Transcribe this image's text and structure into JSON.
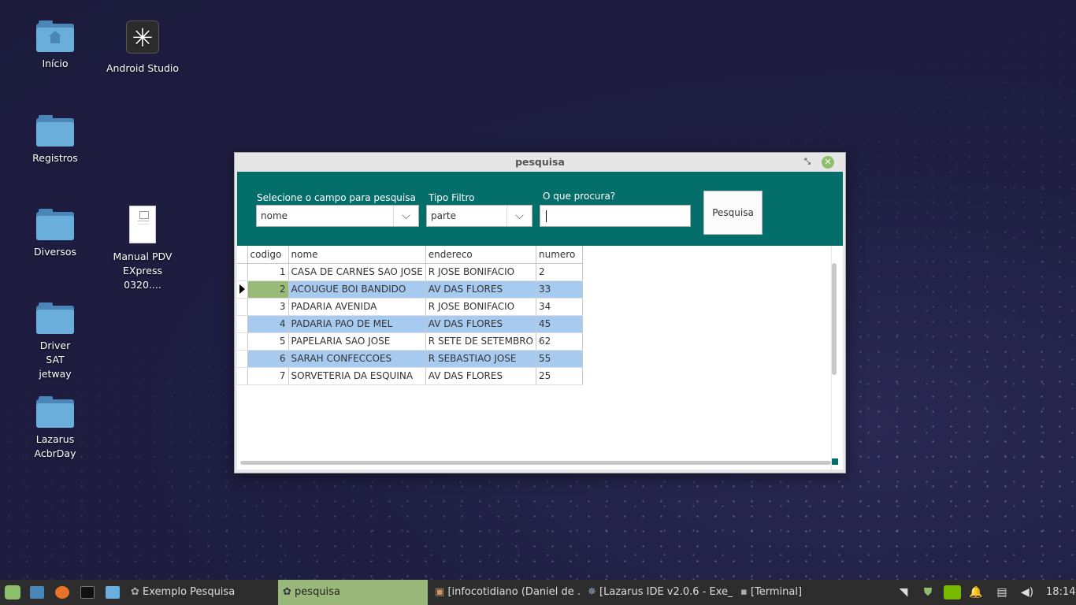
{
  "desktop": {
    "icons": [
      {
        "label": "Início"
      },
      {
        "label": "Android Studio"
      },
      {
        "label": "Registros"
      },
      {
        "label": "Diversos"
      },
      {
        "label": "Manual PDV EXpress 0320...."
      },
      {
        "label": "Driver SAT jetway"
      },
      {
        "label": "Lazarus AcbrDay"
      }
    ]
  },
  "window": {
    "title": "pesquisa",
    "field_label": "Selecione o campo para pesquisa",
    "field_value": "nome",
    "filter_label": "Tipo Filtro",
    "filter_value": "parte",
    "search_label": "O que procura?",
    "search_value": "",
    "search_button": "Pesquisa",
    "columns": [
      "codigo",
      "nome",
      "endereco",
      "numero"
    ],
    "rows": [
      [
        "1",
        "CASA DE CARNES SAO JOSE",
        "R JOSE BONIFACIO",
        "2"
      ],
      [
        "2",
        "ACOUGUE BOI BANDIDO",
        "AV DAS FLORES",
        "33"
      ],
      [
        "3",
        "PADARIA AVENIDA",
        "R JOSE BONIFACIO",
        "34"
      ],
      [
        "4",
        "PADARIA PAO DE MEL",
        "AV DAS FLORES",
        "45"
      ],
      [
        "5",
        "PAPELARIA SAO JOSE",
        "R SETE DE SETEMBRO",
        "62"
      ],
      [
        "6",
        "SARAH CONFECCOES",
        "R SEBASTIAO JOSE",
        "55"
      ],
      [
        "7",
        "SORVETERIA DA ESQUINA",
        "AV DAS FLORES",
        "25"
      ]
    ]
  },
  "taskbar": {
    "items": [
      {
        "label": "Exemplo Pesquisa"
      },
      {
        "label": "pesquisa"
      },
      {
        "label": "[infocotidiano (Daniel de ..."
      },
      {
        "label": "[Lazarus IDE v2.0.6 - Exe_..."
      },
      {
        "label": "[Terminal]"
      }
    ],
    "clock": "18:14"
  },
  "colors": {
    "panel": "#046e6a",
    "row_alt": "#a6caf0",
    "row_selected_code": "#99bb77",
    "taskbar_active": "#9ab87a"
  }
}
